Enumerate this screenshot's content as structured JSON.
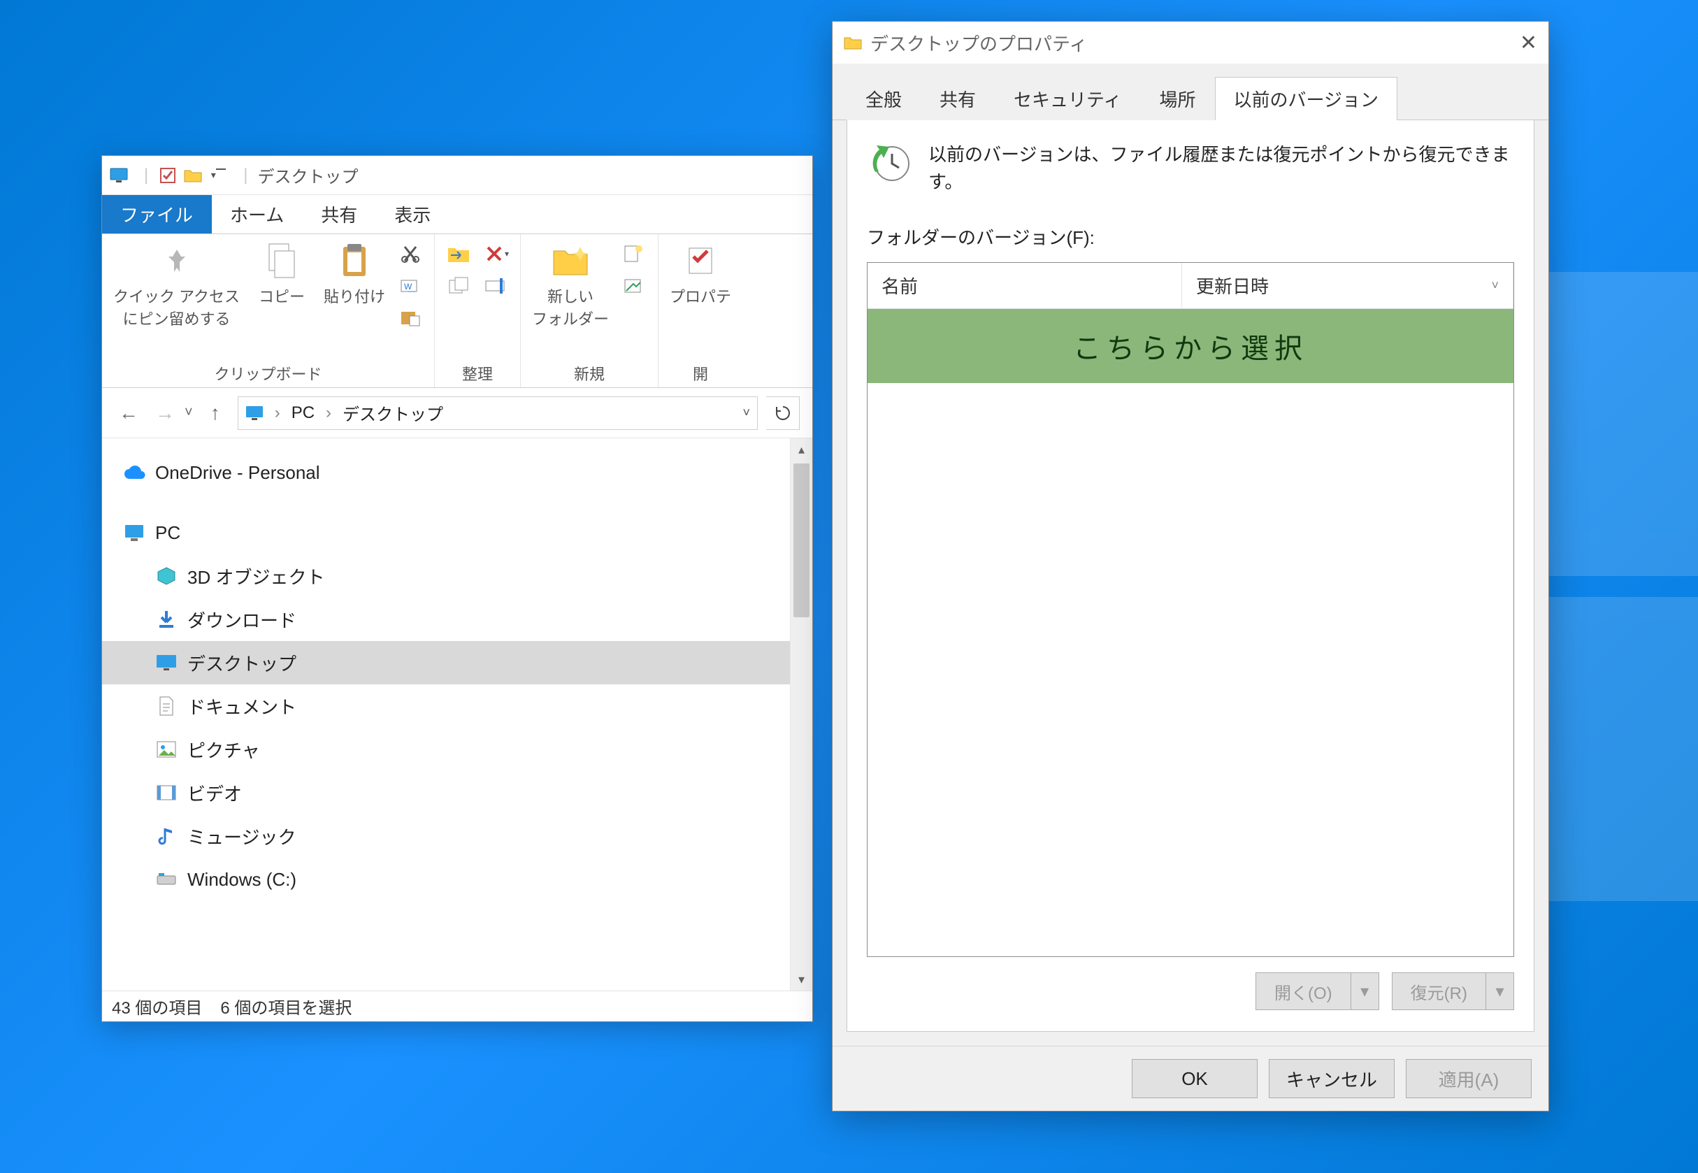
{
  "explorer": {
    "title": "デスクトップ",
    "tabs": {
      "file": "ファイル",
      "home": "ホーム",
      "share": "共有",
      "view": "表示"
    },
    "ribbon": {
      "pin": "クイック アクセス\nにピン留めする",
      "copy": "コピー",
      "paste": "貼り付け",
      "clipboard": "クリップボード",
      "organize": "整理",
      "newfolder": "新しい\nフォルダー",
      "new": "新規",
      "properties": "プロパテ",
      "open": "開"
    },
    "breadcrumb": {
      "pc": "PC",
      "desktop": "デスクトップ"
    },
    "nav": {
      "onedrive": "OneDrive - Personal",
      "pc": "PC",
      "items": [
        "3D オブジェクト",
        "ダウンロード",
        "デスクトップ",
        "ドキュメント",
        "ピクチャ",
        "ビデオ",
        "ミュージック",
        "Windows (C:)"
      ],
      "selected_index": 2
    },
    "status": {
      "count": "43 個の項目",
      "selection": "6 個の項目を選択"
    }
  },
  "props": {
    "title": "デスクトップのプロパティ",
    "tabs": [
      "全般",
      "共有",
      "セキュリティ",
      "場所",
      "以前のバージョン"
    ],
    "active_tab": 4,
    "info": "以前のバージョンは、ファイル履歴または復元ポイントから復元できます。",
    "folder_label": "フォルダーのバージョン(F):",
    "columns": {
      "name": "名前",
      "date": "更新日時"
    },
    "banner": "こちらから選択",
    "open_btn": "開く(O)",
    "restore_btn": "復元(R)",
    "ok": "OK",
    "cancel": "キャンセル",
    "apply": "適用(A)"
  }
}
